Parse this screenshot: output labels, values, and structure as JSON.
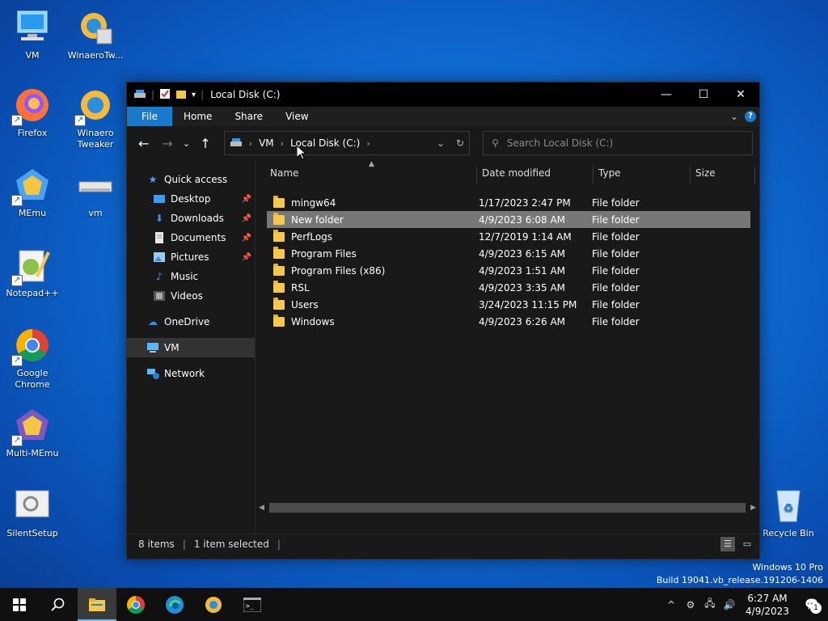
{
  "desktop": {
    "icons": [
      {
        "label": "VM"
      },
      {
        "label": "WinaeroTw..."
      },
      {
        "label": "Firefox"
      },
      {
        "label": "Winaero Tweaker"
      },
      {
        "label": "MEmu"
      },
      {
        "label": "vm"
      },
      {
        "label": "Notepad++"
      },
      {
        "label": "Google Chrome"
      },
      {
        "label": "Multi-MEmu"
      },
      {
        "label": "SilentSetup"
      },
      {
        "label": "Recycle Bin"
      }
    ]
  },
  "window": {
    "title": "Local Disk (C:)",
    "ribbon_tabs": [
      "File",
      "Home",
      "Share",
      "View"
    ],
    "help_label": "?",
    "breadcrumb": [
      "VM",
      "Local Disk (C:)"
    ],
    "search_placeholder": "Search Local Disk (C:)",
    "nav_pane": {
      "quick_access": "Quick access",
      "items": [
        {
          "label": "Desktop",
          "pinned": true
        },
        {
          "label": "Downloads",
          "pinned": true
        },
        {
          "label": "Documents",
          "pinned": true
        },
        {
          "label": "Pictures",
          "pinned": true
        },
        {
          "label": "Music",
          "pinned": false
        },
        {
          "label": "Videos",
          "pinned": false
        }
      ],
      "onedrive": "OneDrive",
      "vm": "VM",
      "network": "Network"
    },
    "columns": {
      "name": "Name",
      "date": "Date modified",
      "type": "Type",
      "size": "Size"
    },
    "files": [
      {
        "name": "mingw64",
        "date": "1/17/2023 2:47 PM",
        "type": "File folder"
      },
      {
        "name": "New folder",
        "date": "4/9/2023 6:08 AM",
        "type": "File folder",
        "selected": true
      },
      {
        "name": "PerfLogs",
        "date": "12/7/2019 1:14 AM",
        "type": "File folder"
      },
      {
        "name": "Program Files",
        "date": "4/9/2023 6:15 AM",
        "type": "File folder"
      },
      {
        "name": "Program Files (x86)",
        "date": "4/9/2023 1:51 AM",
        "type": "File folder"
      },
      {
        "name": "RSL",
        "date": "4/9/2023 3:35 AM",
        "type": "File folder"
      },
      {
        "name": "Users",
        "date": "3/24/2023 11:15 PM",
        "type": "File folder"
      },
      {
        "name": "Windows",
        "date": "4/9/2023 6:26 AM",
        "type": "File folder"
      }
    ],
    "status": {
      "count": "8 items",
      "selection": "1 item selected"
    }
  },
  "watermark": {
    "line1": "Windows 10 Pro",
    "line2": "Build 19041.vb_release.191206-1406"
  },
  "taskbar": {
    "time": "6:27 AM",
    "date": "4/9/2023",
    "notification_count": "1"
  },
  "colors": {
    "accent": "#1979ca",
    "folder": "#f5c84c",
    "selected_row": "#777777"
  }
}
